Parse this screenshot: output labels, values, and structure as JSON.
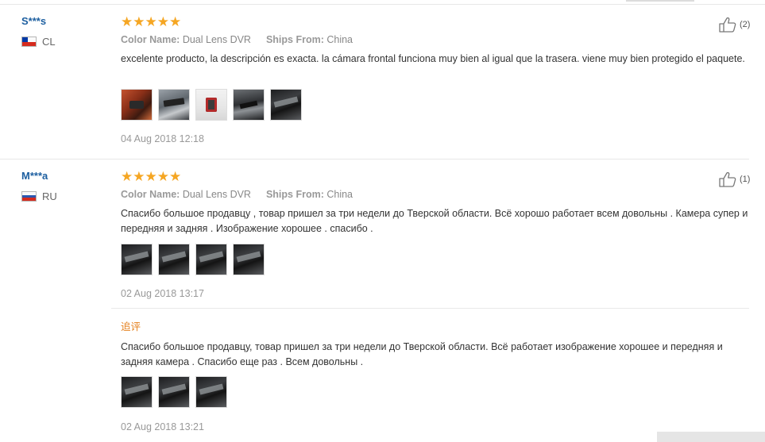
{
  "reviews": [
    {
      "user": "S***s",
      "country": "CL",
      "helpful_count": "(2)",
      "rating": "★★★★★",
      "color_label": "Color Name:",
      "color_value": "Dual Lens DVR",
      "ships_label": "Ships From:",
      "ships_value": "China",
      "text": "excelente producto, la descripción es exacta. la cámara frontal funciona muy bien al igual que la trasera. viene muy bien protegido el paquete.",
      "images": [
        "red-dashcam-photo",
        "mirror-camera-photo",
        "camera-on-white-photo",
        "windshield-camera-photo",
        "car-camera-photo"
      ],
      "date": "04 Aug 2018 12:18"
    },
    {
      "user": "M***a",
      "country": "RU",
      "helpful_count": "(1)",
      "rating": "★★★★★",
      "color_label": "Color Name:",
      "color_value": "Dual Lens DVR",
      "ships_label": "Ships From:",
      "ships_value": "China",
      "text": "Спасибо большое продавцу , товар пришел за три недели до Тверской области. Всё хорошо работает всем довольны . Камера супер и передняя и задняя . Изображение хорошее . спасибо .",
      "images": [
        "dark-car-photo-1",
        "dark-car-photo-2",
        "dark-car-photo-3",
        "dark-car-photo-4"
      ],
      "date": "02 Aug 2018 13:17",
      "followup": {
        "label": "追评",
        "text": "Спасибо большое продавцу, товар пришел за три недели до Тверской области. Всё работает изображение хорошее и передняя и задняя камера . Спасибо еще раз . Всем довольны .",
        "images": [
          "dark-car-photo-5",
          "dark-car-photo-6",
          "dark-car-photo-7"
        ],
        "date": "02 Aug 2018 13:21"
      }
    }
  ],
  "colors": {
    "username": "#1d5fa0",
    "stars": "#f5a623",
    "followup_label": "#e5801d",
    "date": "#999999"
  },
  "icons": {
    "helpful": "thumbs-up-icon",
    "flag_cl": "chile-flag-icon",
    "flag_ru": "russia-flag-icon"
  }
}
